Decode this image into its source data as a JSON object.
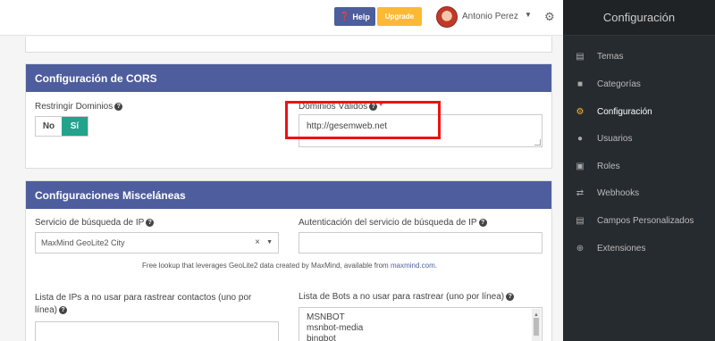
{
  "topbar": {
    "help_label": "Help",
    "upgrade_label": "Upgrade",
    "user_name": "Antonio Perez"
  },
  "cors": {
    "title": "Configuración de CORS",
    "restrict_label": "Restringir Dominios",
    "toggle_no": "No",
    "toggle_si": "Sí",
    "valid_domains_label": "Dominios Válidos",
    "valid_domains_value": "http://gesemweb.net"
  },
  "misc": {
    "title": "Configuraciones Misceláneas",
    "ip_service_label": "Servicio de búsqueda de IP",
    "ip_service_value": "MaxMind GeoLite2 City",
    "ip_auth_label": "Autenticación del servicio de búsqueda de IP",
    "note_text": "Free lookup that leverages GeoLite2 data created by MaxMind, available from ",
    "note_link": "maxmind.com",
    "note_end": ".",
    "ips_label_line1": "Lista de IPs a no usar para rastrear contactos (uno por",
    "ips_label_line2": "línea)",
    "bots_label": "Lista de Bots a no usar para rastrear (uno por línea)",
    "bots": [
      "MSNBOT",
      "msnbot-media",
      "bingbot"
    ]
  },
  "sidebar": {
    "title": "Configuración",
    "items": [
      {
        "label": "Temas",
        "icon": "theme-icon"
      },
      {
        "label": "Categorías",
        "icon": "folder-icon"
      },
      {
        "label": "Configuración",
        "icon": "cogs-icon"
      },
      {
        "label": "Usuarios",
        "icon": "users-icon"
      },
      {
        "label": "Roles",
        "icon": "lock-icon"
      },
      {
        "label": "Webhooks",
        "icon": "exchange-icon"
      },
      {
        "label": "Campos Personalizados",
        "icon": "list-icon"
      },
      {
        "label": "Extensiones",
        "icon": "plus-circle-icon"
      }
    ],
    "active_color": "#fdb933"
  },
  "colors": {
    "panel_header": "#4e5d9d",
    "toggle_active": "#23a28c",
    "highlight": "#e11111"
  }
}
